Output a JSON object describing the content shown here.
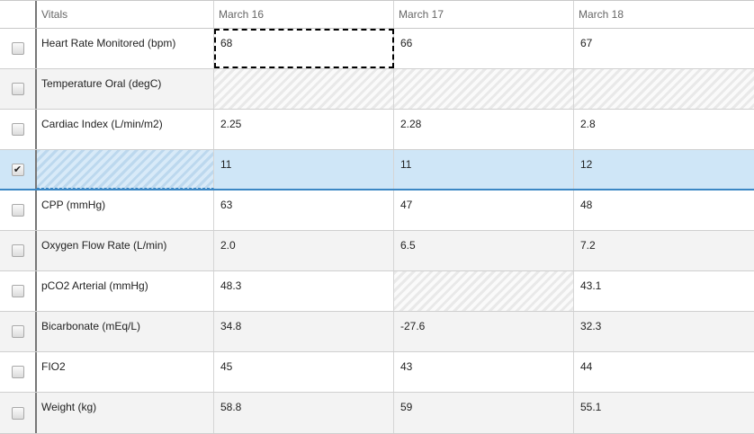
{
  "header": {
    "vitals_label": "Vitals",
    "columns": [
      "March 16",
      "March 17",
      "March 18"
    ]
  },
  "rows": [
    {
      "label": "Heart Rate Monitored (bpm)",
      "values": [
        "68",
        "66",
        "67"
      ],
      "checked": false
    },
    {
      "label": "Temperature Oral (degC)",
      "values": [
        "",
        "",
        ""
      ],
      "checked": false
    },
    {
      "label": "Cardiac Index (L/min/m2)",
      "values": [
        "2.25",
        "2.28",
        "2.8"
      ],
      "checked": false
    },
    {
      "label": "",
      "values": [
        "11",
        "11",
        "12"
      ],
      "checked": true
    },
    {
      "label": "CPP (mmHg)",
      "values": [
        "63",
        "47",
        "48"
      ],
      "checked": false
    },
    {
      "label": "Oxygen Flow Rate (L/min)",
      "values": [
        "2.0",
        "6.5",
        "7.2"
      ],
      "checked": false
    },
    {
      "label": "pCO2 Arterial (mmHg)",
      "values": [
        "48.3",
        "",
        "43.1"
      ],
      "checked": false
    },
    {
      "label": "Bicarbonate (mEq/L)",
      "values": [
        "34.8",
        "-27.6",
        "32.3"
      ],
      "checked": false
    },
    {
      "label": "FIO2",
      "values": [
        "45",
        "43",
        "44"
      ],
      "checked": false
    },
    {
      "label": "Weight (kg)",
      "values": [
        "58.8",
        "59",
        "55.1"
      ],
      "checked": false
    }
  ],
  "checkmark_glyph": "✔"
}
